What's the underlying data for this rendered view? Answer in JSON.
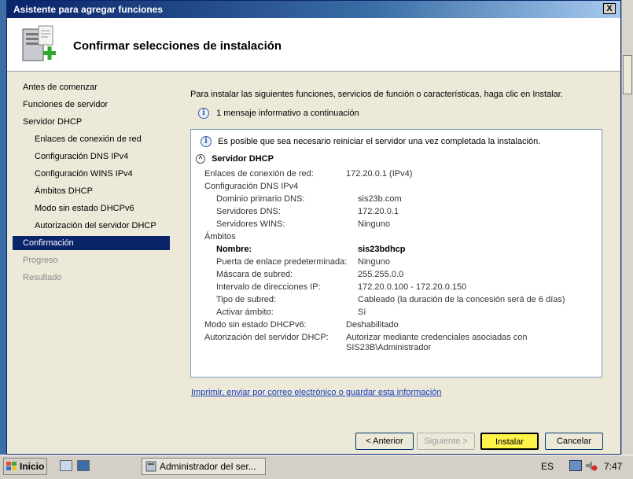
{
  "window": {
    "title": "Asistente para agregar funciones",
    "close_label": "X"
  },
  "header": {
    "title": "Confirmar selecciones de instalación"
  },
  "sidebar": {
    "items": [
      {
        "label": "Antes de comenzar",
        "state": "normal"
      },
      {
        "label": "Funciones de servidor",
        "state": "normal"
      },
      {
        "label": "Servidor DHCP",
        "state": "normal"
      },
      {
        "label": "Enlaces de conexión de red",
        "state": "sub"
      },
      {
        "label": "Configuración DNS IPv4",
        "state": "sub"
      },
      {
        "label": "Configuración WINS IPv4",
        "state": "sub"
      },
      {
        "label": "Ámbitos DHCP",
        "state": "sub"
      },
      {
        "label": "Modo sin estado DHCPv6",
        "state": "sub"
      },
      {
        "label": "Autorización del servidor DHCP",
        "state": "sub"
      },
      {
        "label": "Confirmación",
        "state": "active"
      },
      {
        "label": "Progreso",
        "state": "disabled"
      },
      {
        "label": "Resultado",
        "state": "disabled"
      }
    ]
  },
  "content": {
    "intro": "Para instalar las siguientes funciones, servicios de función o características, haga clic en Instalar.",
    "info_count": "1 mensaje informativo a continuación",
    "info_glyph": "i",
    "warning": "Es posible que sea necesario reiniciar el servidor una vez completada la instalación.",
    "section_title": "Servidor DHCP",
    "collapse_glyph": "^",
    "details": [
      {
        "label": "Enlaces de conexión de red:",
        "value": "172.20.0.1 (IPv4)",
        "indent": 0,
        "bold": false
      },
      {
        "label": "Configuración DNS IPv4",
        "value": "",
        "indent": 0,
        "bold": false
      },
      {
        "label": "Dominio primario DNS:",
        "value": "sis23b.com",
        "indent": 1,
        "bold": false
      },
      {
        "label": "Servidores DNS:",
        "value": "172.20.0.1",
        "indent": 1,
        "bold": false
      },
      {
        "label": "Servidores WINS:",
        "value": "Ninguno",
        "indent": 1,
        "bold": false
      },
      {
        "label": "Ámbitos",
        "value": "",
        "indent": 0,
        "bold": false
      },
      {
        "label": "Nombre:",
        "value": "sis23bdhcp",
        "indent": 1,
        "bold": true
      },
      {
        "label": "Puerta de enlace predeterminada:",
        "value": "Ninguno",
        "indent": 1,
        "bold": false
      },
      {
        "label": "Máscara de subred:",
        "value": "255.255.0.0",
        "indent": 1,
        "bold": false
      },
      {
        "label": "Intervalo de direcciones IP:",
        "value": "172.20.0.100 - 172.20.0.150",
        "indent": 1,
        "bold": false
      },
      {
        "label": "Tipo de subred:",
        "value": "Cableado (la duración de la concesión será de 6 días)",
        "indent": 1,
        "bold": false
      },
      {
        "label": "Activar ámbito:",
        "value": "Sí",
        "indent": 1,
        "bold": false
      },
      {
        "label": "Modo sin estado DHCPv6:",
        "value": "Deshabilitado",
        "indent": 0,
        "bold": false
      },
      {
        "label": "Autorización del servidor DHCP:",
        "value": "Autorizar mediante credenciales asociadas con",
        "indent": 0,
        "bold": false
      },
      {
        "label": "",
        "value": "SIS23B\\Administrador",
        "indent": 0,
        "bold": false
      }
    ],
    "link": "Imprimir, enviar por correo electrónico o guardar esta información"
  },
  "buttons": {
    "back": "< Anterior",
    "next": "Siguiente >",
    "install": "Instalar",
    "cancel": "Cancelar"
  },
  "taskbar": {
    "start_label": "Inicio",
    "task_label": "Administrador del ser...",
    "language": "ES",
    "clock": "7:47"
  },
  "colors": {
    "highlight": "#fff34a",
    "selection": "#0a246a",
    "link": "#1a3dba"
  }
}
